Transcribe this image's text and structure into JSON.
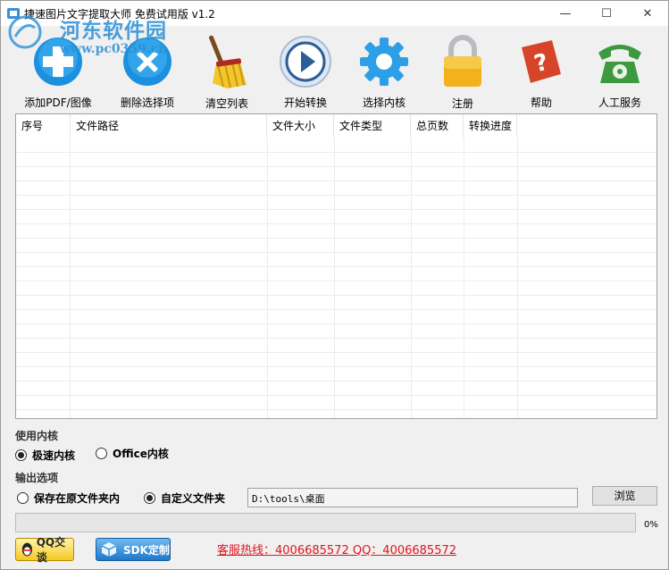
{
  "window": {
    "title": "捷速图片文字提取大师 免费试用版 v1.2",
    "controls": {
      "minimize": "—",
      "maximize": "☐",
      "close": "✕"
    }
  },
  "watermark": {
    "name": "河东软件园",
    "url": "www.pc0359.cn"
  },
  "toolbar": [
    {
      "label": "添加PDF/图像",
      "icon": "add-icon"
    },
    {
      "label": "删除选择项",
      "icon": "delete-icon"
    },
    {
      "label": "清空列表",
      "icon": "broom-icon"
    },
    {
      "label": "开始转换",
      "icon": "play-icon"
    },
    {
      "label": "选择内核",
      "icon": "gear-icon"
    },
    {
      "label": "注册",
      "icon": "lock-icon"
    },
    {
      "label": "帮助",
      "icon": "help-book-icon"
    },
    {
      "label": "人工服务",
      "icon": "telephone-icon"
    }
  ],
  "table": {
    "columns": [
      "序号",
      "文件路径",
      "文件大小",
      "文件类型",
      "总页数",
      "转换进度"
    ],
    "rows": []
  },
  "kernel": {
    "title": "使用内核",
    "options": [
      {
        "label": "极速内核",
        "selected": true
      },
      {
        "label": "Office内核",
        "selected": false
      }
    ]
  },
  "output": {
    "title": "输出选项",
    "options": [
      {
        "label": "保存在原文件夹内",
        "selected": false
      },
      {
        "label": "自定义文件夹",
        "selected": true
      }
    ],
    "path": "D:\\tools\\桌面",
    "browse_label": "浏览"
  },
  "progress": {
    "value": 0,
    "text": "0%"
  },
  "bottom": {
    "qq_label": "QQ交谈",
    "sdk_label": "SDK定制",
    "hotline": "客服热线：4006685572 QQ：4006685572"
  },
  "colors": {
    "accent": "#2b8fd6",
    "hotline": "#e0141e",
    "progress": "#06b025"
  }
}
